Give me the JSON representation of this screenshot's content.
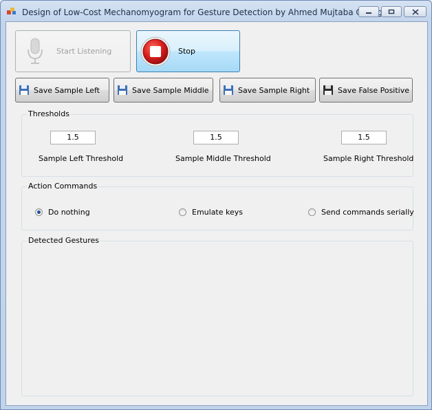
{
  "window": {
    "title": "Design of Low-Cost Mechanomyogram for Gesture Detection by Ahmed Mujtaba Chang",
    "icon": "app-icon",
    "controls": [
      "minimize-icon",
      "maximize-icon",
      "close-icon"
    ]
  },
  "listening": {
    "start_label": "Start Listening",
    "start_icon": "microphone-icon",
    "start_enabled": false,
    "stop_label": "Stop",
    "stop_icon": "stop-icon"
  },
  "save_buttons": {
    "left": "Save Sample Left",
    "middle": "Save Sample Middle",
    "right": "Save Sample Right",
    "false_positive": "Save False Positive",
    "icon": "floppy-disk-icon"
  },
  "thresholds": {
    "legend": "Thresholds",
    "left": {
      "value": "1.5",
      "label": "Sample Left Threshold"
    },
    "middle": {
      "value": "1.5",
      "label": "Sample Middle Threshold"
    },
    "right": {
      "value": "1.5",
      "label": "Sample Right Threshold"
    }
  },
  "actions": {
    "legend": "Action Commands",
    "options": [
      "Do nothing",
      "Emulate keys",
      "Send commands serially"
    ],
    "selected": "Do nothing"
  },
  "gestures": {
    "legend": "Detected Gestures",
    "items": []
  },
  "colors": {
    "accent": "#3c7fb1",
    "stop_red": "#d81e1e",
    "title_bar": "#c4d6ec"
  }
}
